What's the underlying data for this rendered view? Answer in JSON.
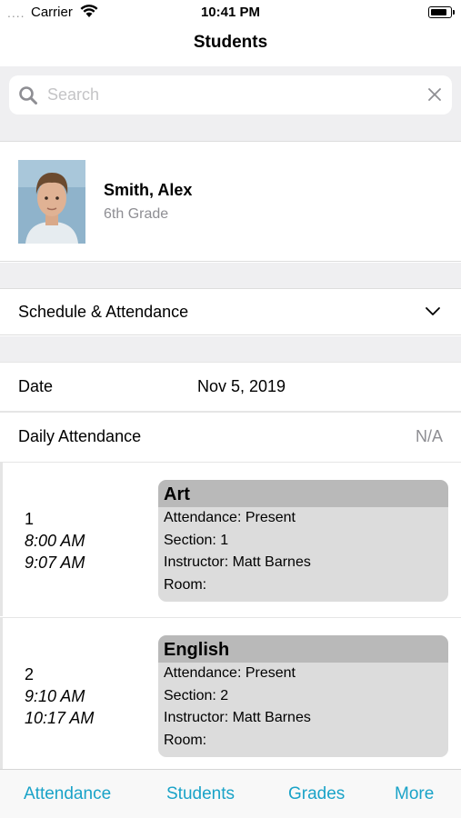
{
  "status": {
    "signal": "....",
    "carrier": "Carrier",
    "time": "10:41 PM"
  },
  "nav": {
    "title": "Students"
  },
  "search": {
    "placeholder": "Search",
    "value": ""
  },
  "student": {
    "name": "Smith, Alex",
    "grade": "6th Grade"
  },
  "section": {
    "label": "Schedule & Attendance"
  },
  "date_row": {
    "label": "Date",
    "value": "Nov 5, 2019"
  },
  "attendance_row": {
    "label": "Daily Attendance",
    "value": "N/A"
  },
  "periods": [
    {
      "number": "1",
      "start": "8:00 AM",
      "end": "9:07 AM",
      "class": "Art",
      "attendance": "Attendance: Present",
      "section": "Section: 1",
      "instructor": "Instructor: Matt Barnes",
      "room": "Room:"
    },
    {
      "number": "2",
      "start": "9:10 AM",
      "end": "10:17 AM",
      "class": "English",
      "attendance": "Attendance: Present",
      "section": "Section: 2",
      "instructor": "Instructor: Matt Barnes",
      "room": "Room:"
    }
  ],
  "tabs": [
    {
      "label": "Attendance"
    },
    {
      "label": "Students"
    },
    {
      "label": "Grades"
    },
    {
      "label": "More"
    }
  ],
  "colors": {
    "accent": "#1aa3c8",
    "group_background": "#efeff1",
    "class_card": "#dcdcdc",
    "class_card_header": "#b9b9b9"
  }
}
